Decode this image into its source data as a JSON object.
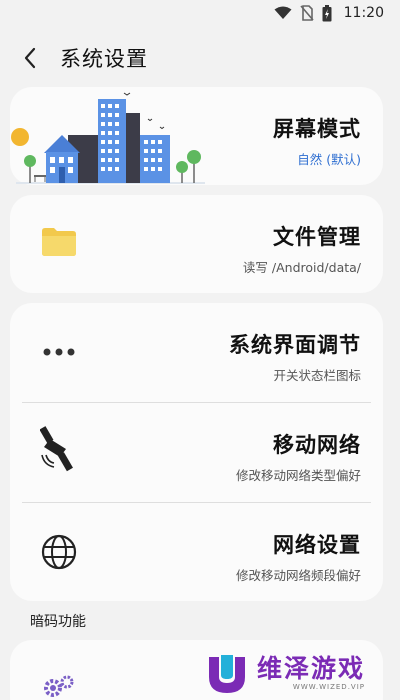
{
  "status_bar": {
    "time": "11:20",
    "icons": [
      "wifi-icon",
      "no-sim-icon",
      "battery-charging-icon"
    ]
  },
  "header": {
    "back_icon": "chevron-left-icon",
    "title": "系统设置"
  },
  "rows": {
    "display_mode": {
      "title": "屏幕模式",
      "subtitle": "自然 (默认)",
      "icon": "city-illustration"
    },
    "file_manager": {
      "title": "文件管理",
      "subtitle": "读写 /Android/data/",
      "icon": "folder-icon"
    },
    "system_ui": {
      "title": "系统界面调节",
      "subtitle": "开关状态栏图标",
      "icon": "more-dots-icon"
    },
    "mobile_network": {
      "title": "移动网络",
      "subtitle": "修改移动网络类型偏好",
      "icon": "satellite-icon"
    },
    "network_settings": {
      "title": "网络设置",
      "subtitle": "修改移动网络频段偏好",
      "icon": "globe-icon"
    }
  },
  "section": {
    "secret_codes_label": "暗码功能"
  },
  "watermark": {
    "text": "维泽游戏",
    "url": "WWW.WIZED.VIP"
  },
  "colors": {
    "accent": "#2f6fd1",
    "background": "#f2f2f2",
    "card": "#fbfbfb",
    "watermark": "#7b2bb5"
  }
}
